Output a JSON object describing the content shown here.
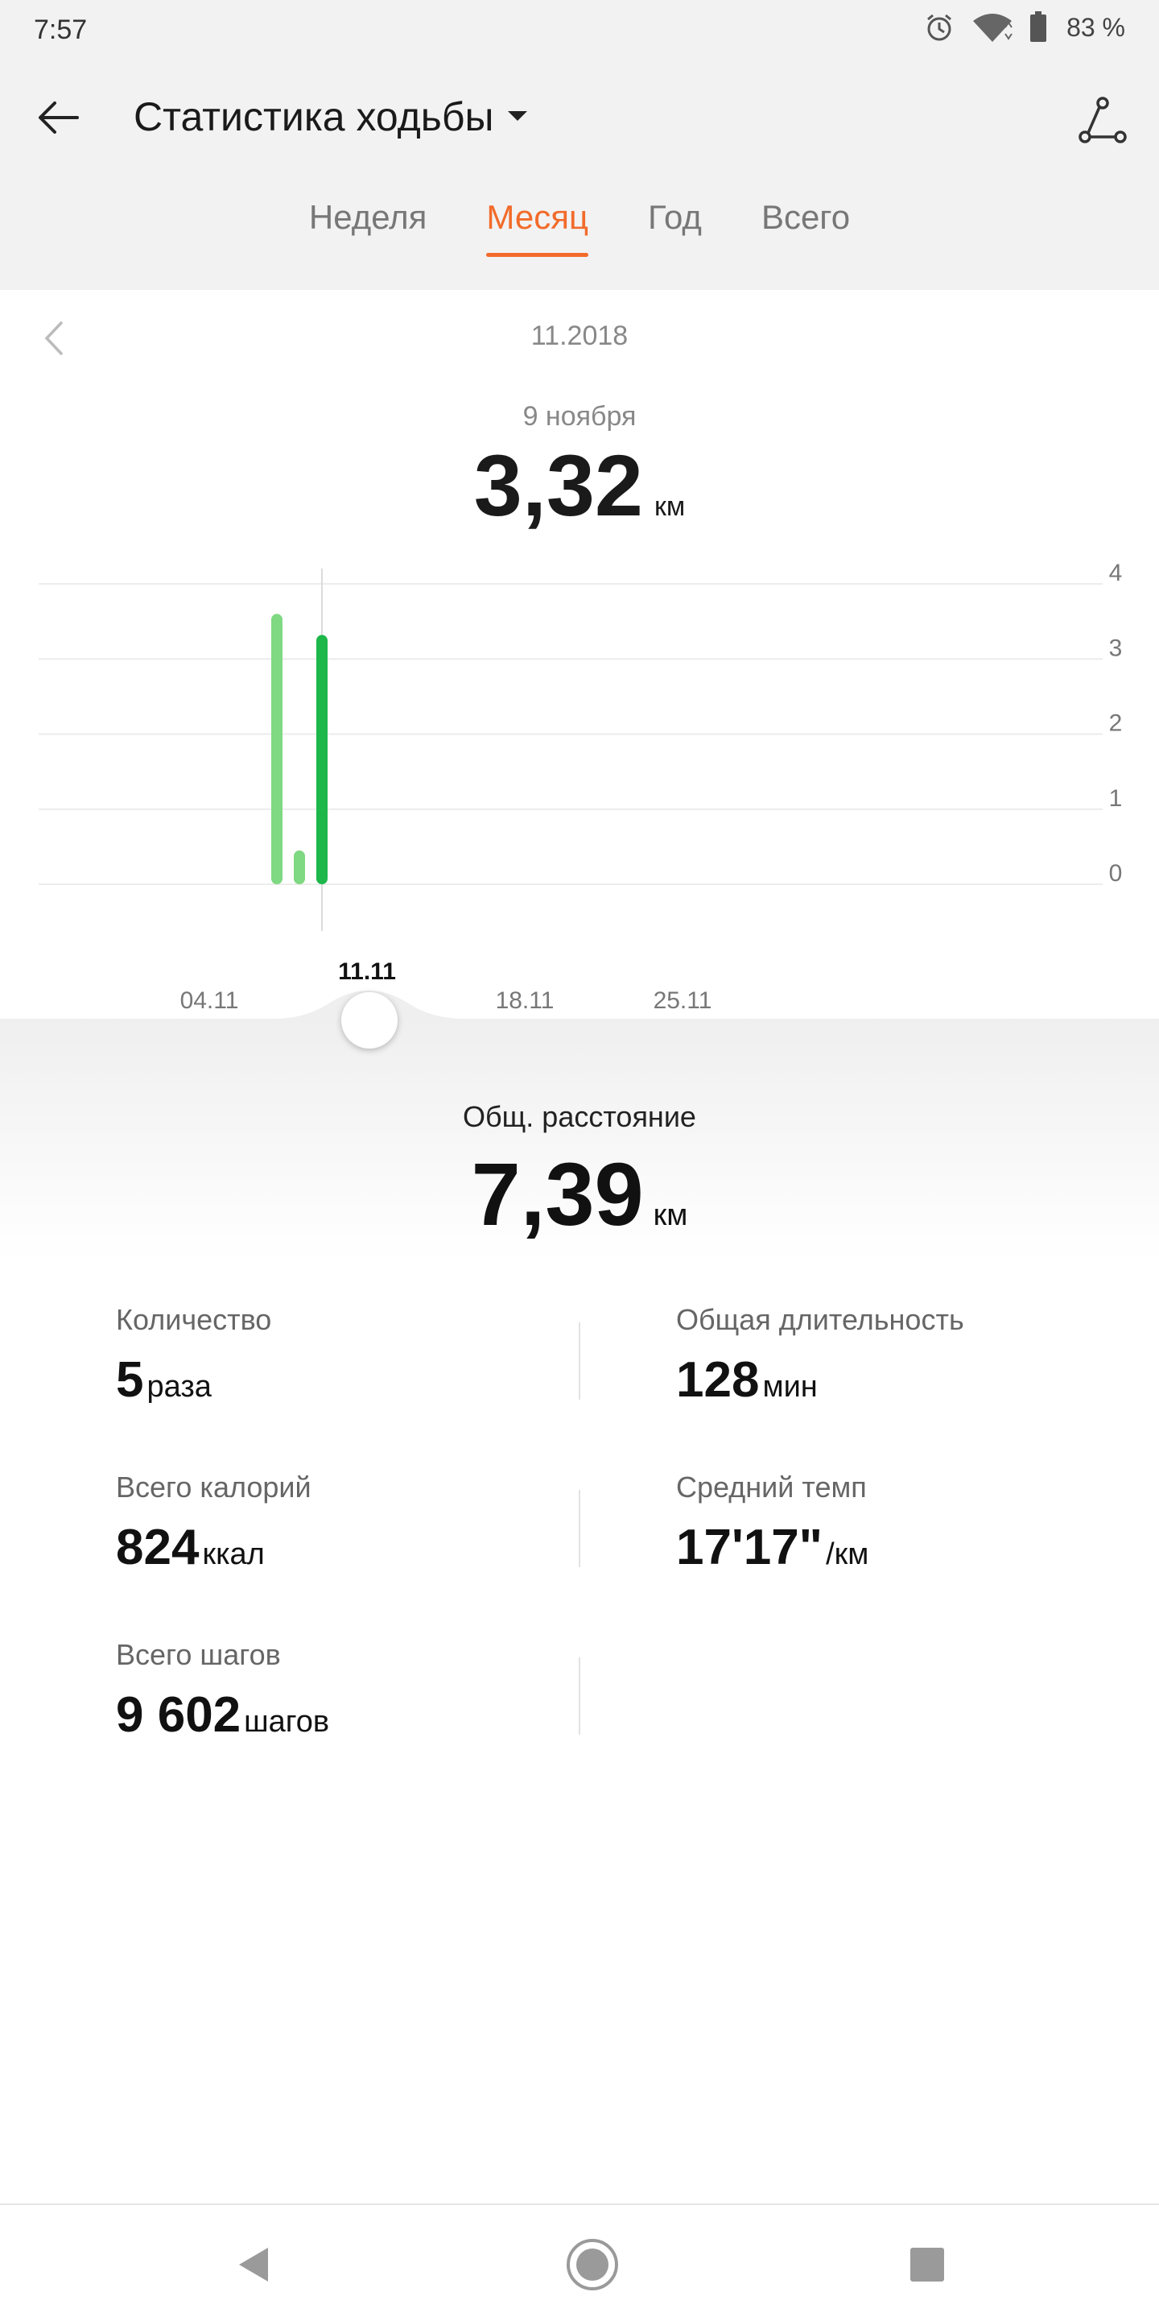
{
  "status_bar": {
    "time": "7:57",
    "battery": "83 %"
  },
  "app_bar": {
    "title": "Статистика ходьбы"
  },
  "tabs": [
    {
      "label": "Неделя",
      "active": false
    },
    {
      "label": "Месяц",
      "active": true
    },
    {
      "label": "Год",
      "active": false
    },
    {
      "label": "Всего",
      "active": false
    }
  ],
  "chart_header": {
    "month": "11.2018",
    "selected_date": "9 ноября",
    "selected_value": "3,32",
    "unit": "км"
  },
  "chart_data": {
    "type": "bar",
    "x_ticks": [
      "04.11",
      "11.11",
      "18.11",
      "25.11"
    ],
    "highlighted_tick": "11.11",
    "y_ticks": [
      "0",
      "1",
      "2",
      "3",
      "4"
    ],
    "ylim": [
      0,
      4
    ],
    "bars": [
      {
        "day": 7,
        "value": 3.6,
        "selected": false
      },
      {
        "day": 8,
        "value": 0.45,
        "selected": false
      },
      {
        "day": 9,
        "value": 3.32,
        "selected": true
      }
    ],
    "colors": {
      "bar": "#7fd882",
      "selected_bar": "#1db74a",
      "grid": "#ececec"
    }
  },
  "summary": {
    "label": "Общ. расстояние",
    "value": "7,39",
    "unit": "км"
  },
  "stats": [
    {
      "label": "Количество",
      "value": "5",
      "unit": "раза"
    },
    {
      "label": "Общая длительность",
      "value": "128",
      "unit": "мин"
    },
    {
      "label": "Всего калорий",
      "value": "824",
      "unit": "ккал"
    },
    {
      "label": "Средний темп",
      "value": "17'17\"",
      "unit": "/км"
    },
    {
      "label": "Всего шагов",
      "value": "9 602",
      "unit": "шагов"
    }
  ],
  "colors": {
    "accent": "#f26b2a",
    "green": "#1db74a",
    "light_green": "#7fd882"
  }
}
